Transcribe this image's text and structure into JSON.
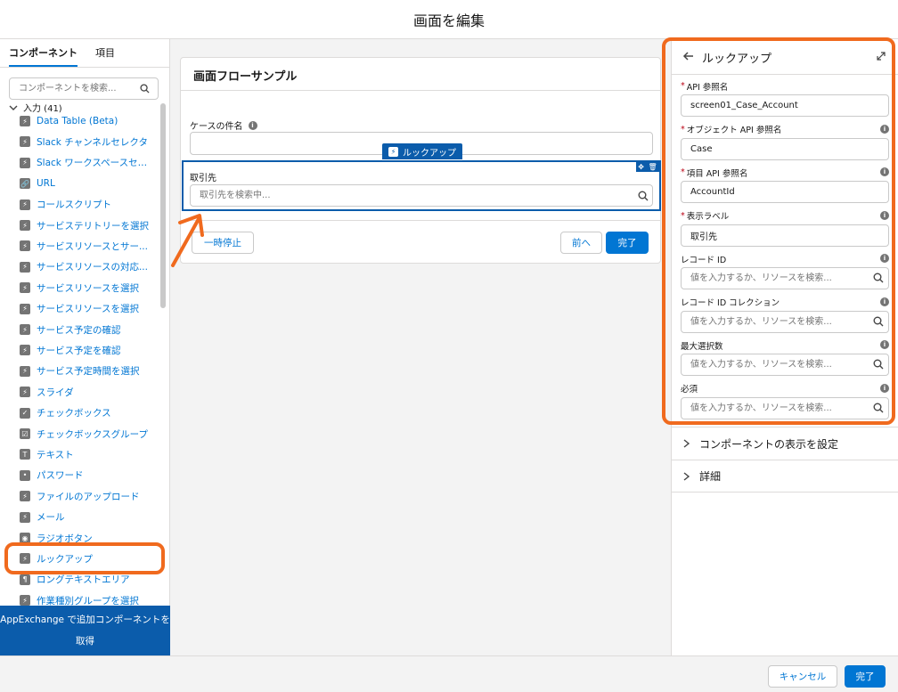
{
  "header": {
    "title": "画面を編集"
  },
  "left": {
    "tabs": [
      "コンポーネント",
      "項目"
    ],
    "search_placeholder": "コンポーネントを検索...",
    "section": "入力 (41)",
    "items": [
      {
        "label": "Data Table (Beta)",
        "icon": "bolt-icon"
      },
      {
        "label": "Slack チャンネルセレクタ",
        "icon": "bolt-icon"
      },
      {
        "label": "Slack ワークスペースセレ...",
        "icon": "bolt-icon"
      },
      {
        "label": "URL",
        "icon": "link-icon"
      },
      {
        "label": "コールスクリプト",
        "icon": "bolt-icon"
      },
      {
        "label": "サービステリトリーを選択",
        "icon": "bolt-icon"
      },
      {
        "label": "サービスリソースとサー...",
        "icon": "bolt-icon"
      },
      {
        "label": "サービスリソースの対応...",
        "icon": "bolt-icon"
      },
      {
        "label": "サービスリソースを選択",
        "icon": "bolt-icon"
      },
      {
        "label": "サービスリソースを選択",
        "icon": "bolt-icon"
      },
      {
        "label": "サービス予定の確認",
        "icon": "bolt-icon"
      },
      {
        "label": "サービス予定を確認",
        "icon": "bolt-icon"
      },
      {
        "label": "サービス予定時間を選択",
        "icon": "bolt-icon"
      },
      {
        "label": "スライダ",
        "icon": "bolt-icon"
      },
      {
        "label": "チェックボックス",
        "icon": "checkbox-icon"
      },
      {
        "label": "チェックボックスグループ",
        "icon": "checkbox-group-icon"
      },
      {
        "label": "テキスト",
        "icon": "text-icon"
      },
      {
        "label": "パスワード",
        "icon": "password-icon"
      },
      {
        "label": "ファイルのアップロード",
        "icon": "bolt-icon"
      },
      {
        "label": "メール",
        "icon": "bolt-icon"
      },
      {
        "label": "ラジオボタン",
        "icon": "radio-icon"
      },
      {
        "label": "ルックアップ",
        "icon": "bolt-icon"
      },
      {
        "label": "ロングテキストエリア",
        "icon": "textarea-icon"
      },
      {
        "label": "作業種別グループを選択",
        "icon": "bolt-icon"
      }
    ],
    "appexchange": "AppExchange で追加コンポーネントを取得"
  },
  "canvas": {
    "screen_title": "画面フローサンプル",
    "field1_label": "ケースの件名",
    "selected_tag": "ルックアップ",
    "lookup_label": "取引先",
    "lookup_placeholder": "取引先を検索中...",
    "pause": "一時停止",
    "previous": "前へ",
    "finish": "完了"
  },
  "right": {
    "title": "ルックアップ",
    "fields": [
      {
        "label": "API 参照名",
        "required": "*",
        "value": "screen01_Case_Account",
        "placeholder": "",
        "info": false,
        "search": false
      },
      {
        "label": "オブジェクト API 参照名",
        "required": "*",
        "value": "Case",
        "placeholder": "",
        "info": true,
        "search": false
      },
      {
        "label": "項目 API 参照名",
        "required": "*",
        "value": "AccountId",
        "placeholder": "",
        "info": true,
        "search": false
      },
      {
        "label": "表示ラベル",
        "required": "*",
        "value": "取引先",
        "placeholder": "",
        "info": true,
        "search": false
      },
      {
        "label": "レコード ID",
        "required": "",
        "value": "",
        "placeholder": "値を入力するか、リソースを検索...",
        "info": true,
        "search": true
      },
      {
        "label": "レコード ID コレクション",
        "required": "",
        "value": "",
        "placeholder": "値を入力するか、リソースを検索...",
        "info": true,
        "search": true
      },
      {
        "label": "最大選択数",
        "required": "",
        "value": "",
        "placeholder": "値を入力するか、リソースを検索...",
        "info": true,
        "search": true
      },
      {
        "label": "必須",
        "required": "",
        "value": "",
        "placeholder": "値を入力するか、リソースを検索...",
        "info": true,
        "search": true
      }
    ],
    "sections": [
      "コンポーネントの表示を設定",
      "詳細"
    ]
  },
  "footer": {
    "cancel": "キャンセル",
    "done": "完了"
  },
  "colors": {
    "brand": "#0176d3",
    "brand_dark": "#0b5cab",
    "highlight": "#f06a1e",
    "required": "#ba0517"
  }
}
